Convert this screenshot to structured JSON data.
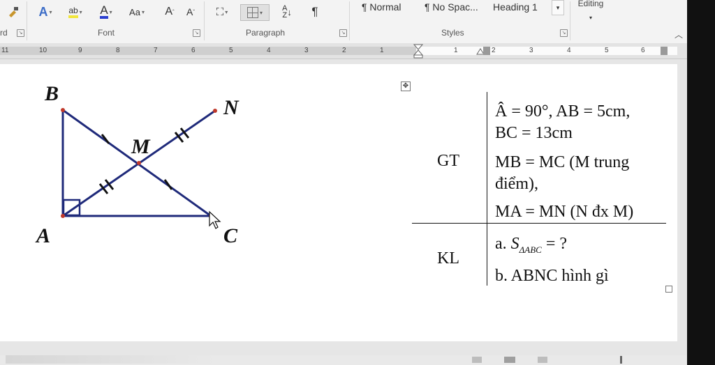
{
  "ribbon": {
    "font_group_label": "Font",
    "paragraph_group_label": "Paragraph",
    "styles_group_label": "Styles",
    "clipboard_partial_label": "rd",
    "grow_font": "A",
    "shrink_font": "A",
    "change_case": "Aa",
    "styles": [
      "¶ Normal",
      "¶ No Spac...",
      "Heading 1"
    ],
    "editing_label": "Editing"
  },
  "ruler": {
    "numbers": [
      "11",
      "10",
      "9",
      "8",
      "7",
      "6",
      "5",
      "4",
      "3",
      "2",
      "1",
      "1",
      "2",
      "3",
      "4",
      "5",
      "6"
    ]
  },
  "figure": {
    "points": {
      "B": "B",
      "N": "N",
      "M": "M",
      "A": "A",
      "C": "C"
    },
    "line_color": "#1f2a7a",
    "point_color": "#c0392b"
  },
  "table": {
    "gt_label": "GT",
    "kl_label": "KL",
    "gt_line1": "Â = 90°, AB = 5cm,",
    "gt_line2": "BC = 13cm",
    "gt_line3": "MB = MC (M trung",
    "gt_line4": "điểm),",
    "gt_line5": "MA = MN (N đx M)",
    "kl_a_prefix": "a.",
    "kl_a_symbol": "S",
    "kl_a_sub": "ΔABC",
    "kl_a_suffix": "= ?",
    "kl_b": "b. ABNC hình gì"
  },
  "colors": {
    "accent": "#2b579a",
    "page": "#ffffff",
    "ribbon": "#f3f3f3"
  }
}
